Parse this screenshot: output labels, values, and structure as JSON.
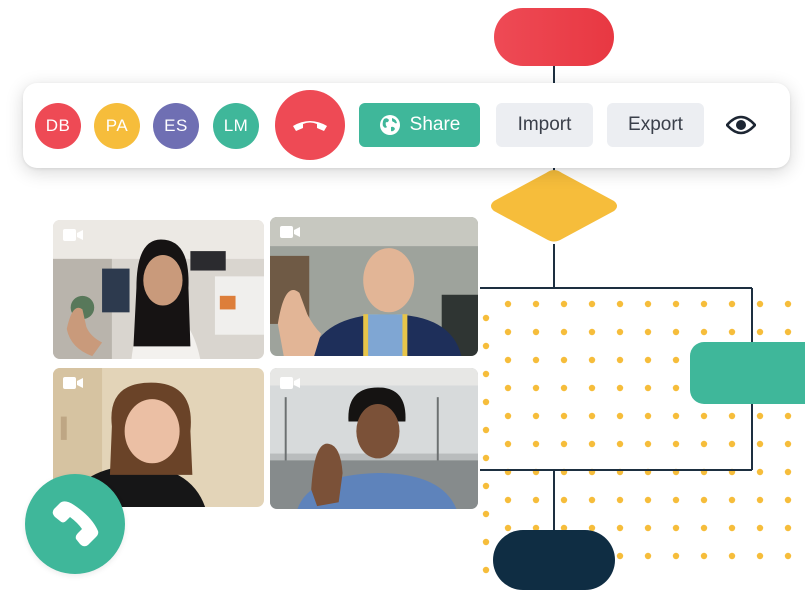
{
  "participants": [
    {
      "initials": "DB",
      "color": "#ee4a55"
    },
    {
      "initials": "PA",
      "color": "#f6bd3b"
    },
    {
      "initials": "ES",
      "color": "#6f6fb3"
    },
    {
      "initials": "LM",
      "color": "#3fb79a"
    }
  ],
  "toolbar": {
    "share_label": "Share",
    "import_label": "Import",
    "export_label": "Export"
  },
  "icons": {
    "hangup": "phone-hangup-icon",
    "share": "globe-icon",
    "visibility": "eye-icon",
    "camera": "video-camera-icon",
    "call": "phone-icon"
  },
  "colors": {
    "red": "#ee4a55",
    "yellow": "#f6bd3b",
    "green": "#3fb79a",
    "navy": "#0f2d43",
    "purple": "#6f6fb3"
  }
}
